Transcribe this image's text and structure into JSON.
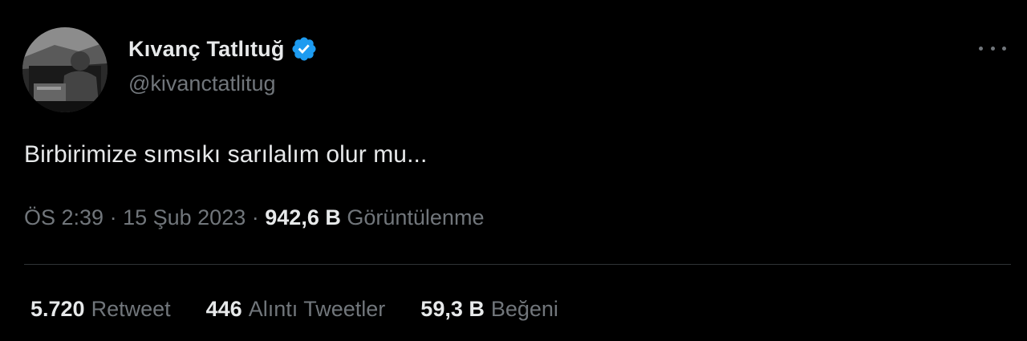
{
  "tweet": {
    "author": {
      "display_name": "Kıvanç Tatlıtuğ",
      "handle": "@kivanctatlitug",
      "verified_icon": "verified-badge-icon",
      "avatar_icon": "profile-avatar"
    },
    "more_icon": "more-options-icon",
    "text": "Birbirimize sımsıkı sarılalım olur mu...",
    "meta": {
      "time": "ÖS 2:39",
      "sep1": "·",
      "date": "15 Şub 2023",
      "sep2": "·",
      "views_count": "942,6 B",
      "views_label": "Görüntülenme"
    },
    "stats": [
      {
        "count": "5.720",
        "label": "Retweet"
      },
      {
        "count": "446",
        "label": "Alıntı Tweetler"
      },
      {
        "count": "59,3 B",
        "label": "Beğeni"
      }
    ]
  },
  "colors": {
    "background": "#000000",
    "primary_text": "#e7e9ea",
    "secondary_text": "#71767b",
    "verified": "#1d9bf0",
    "divider": "#2f3336"
  }
}
